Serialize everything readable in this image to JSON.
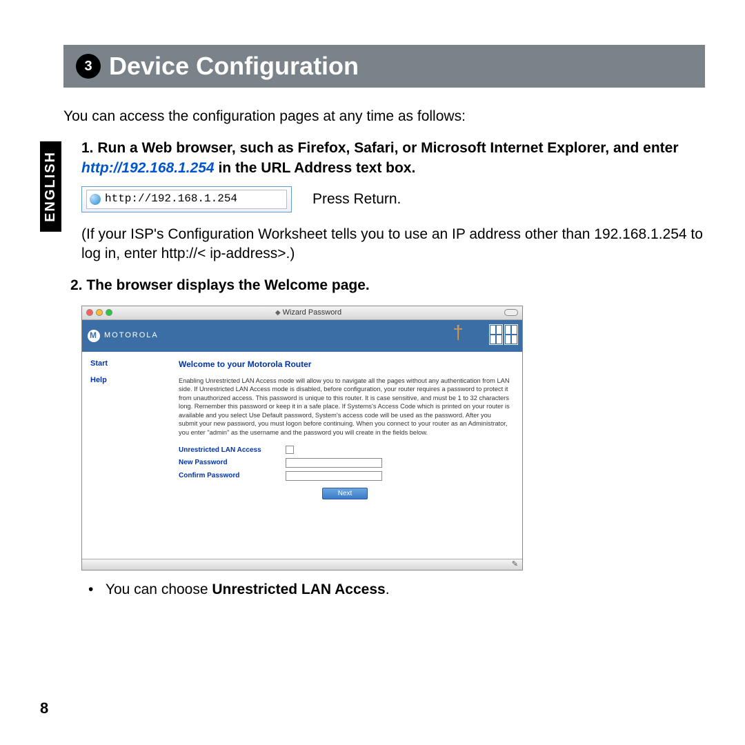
{
  "header": {
    "number": "3",
    "title": "Device Configuration"
  },
  "langTab": "ENGLISH",
  "intro": "You can access the configuration pages at any time as follows:",
  "step1": {
    "prefix": "1. Run a Web browser, such as Firefox, Safari, or Microsoft Internet Explorer, and enter ",
    "url": "http://192.168.1.254",
    "suffix": " in the URL Address text box."
  },
  "urlBoxText": "http://192.168.1.254",
  "pressReturn": "Press Return.",
  "ispNote": "(If your ISP's Configuration Worksheet tells you to use an IP address other than 192.168.1.254 to log in, enter http://< ip-address>.)",
  "step2": "2. The browser displays the Welcome page.",
  "browser": {
    "title": "Wizard Password",
    "logoText": "MOTOROLA",
    "sidebar": [
      "Start",
      "Help"
    ],
    "welcomeHeading": "Welcome to your Motorola Router",
    "welcomeBody": "Enabling Unrestricted LAN Access mode will allow you to navigate all the pages without any authentication from LAN side. If Unrestricted LAN Access mode is disabled, before configuration, your router requires a password to protect it from unauthorized access. This password is unique to this router. It is case sensitive, and must be 1 to 32 characters long. Remember this password or keep it in a safe place. If Systems's Access Code which is printed on your router is available and you select Use Default password, System's access code will be used as the password. After you submit your new password, you must logon before continuing. When you connect to your router as an Administrator, you enter \"admin\" as the username and the password you will create in the fields below.",
    "fields": {
      "unrestricted": "Unrestricted LAN Access",
      "newPassword": "New Password",
      "confirmPassword": "Confirm Password"
    },
    "nextButton": "Next"
  },
  "bullet": {
    "prefix": "You can choose ",
    "bold": "Unrestricted LAN Access",
    "suffix": "."
  },
  "pageNumber": "8"
}
